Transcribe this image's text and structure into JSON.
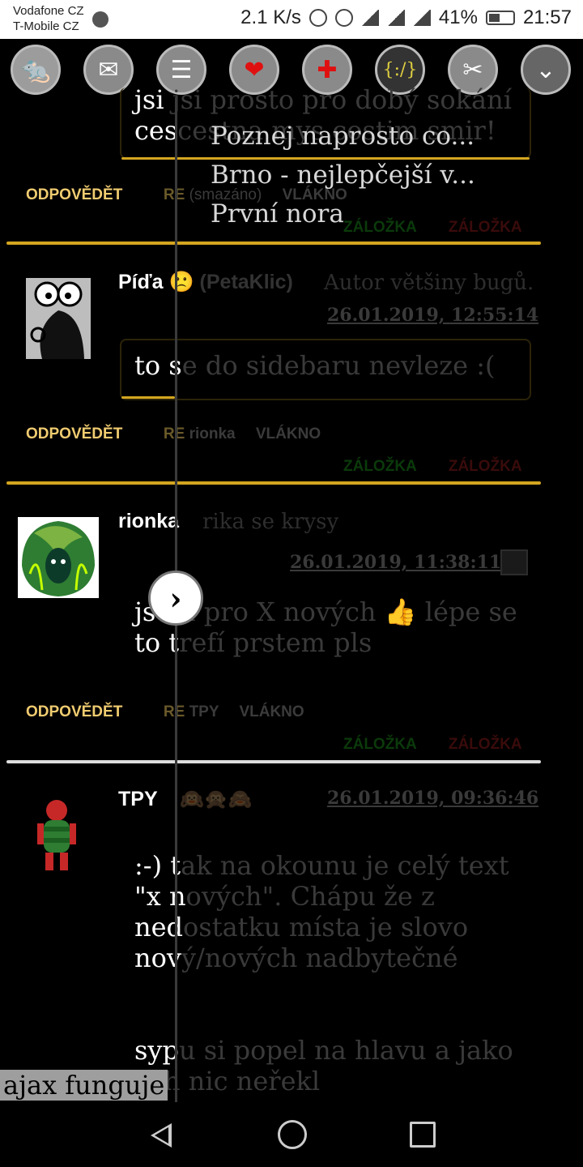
{
  "status_bar": {
    "carrier1": "Vodafone CZ",
    "carrier2": "T-Mobile CZ",
    "speed": "2.1 K/s",
    "battery": "41%",
    "time": "21:57"
  },
  "toolbar": {
    "icons": [
      "profile-icon",
      "mail-icon",
      "list-icon",
      "heart-icon",
      "add-icon",
      "code-icon",
      "tools-icon",
      "expand-icon"
    ]
  },
  "menu": {
    "items": [
      "Poznej naprosto co...",
      "Brno - nejlepčejší v...",
      "První nora"
    ]
  },
  "posts": [
    {
      "text_lines": [
        "jsi prosto pro dobý sokání",
        "cestna mys  costim smir!"
      ],
      "lit_parts": [
        "jsi ",
        "ces"
      ],
      "actions": {
        "reply": "ODPOVĚDĚT",
        "re": "RE",
        "re_target": "(smazáno)",
        "thread": "VLÁKNO"
      },
      "bookmarks": [
        "ZÁLOŽKA",
        "ZÁLOŽKA"
      ]
    },
    {
      "author": "Píďa",
      "emoji": "🙁",
      "nick": "(PetaKlic)",
      "motto": "Autor většiny bugů.",
      "date": "26.01.2019, 12:55:14",
      "text_lit": "to s",
      "text_rest": "e do sidebaru nevleze :(",
      "actions": {
        "reply": "ODPOVĚDĚT",
        "re": "RE",
        "re_target": "rionka",
        "thread": "VLÁKNO"
      },
      "bookmarks": [
        "ZÁLOŽKA",
        "ZÁLOŽKA"
      ]
    },
    {
      "author": "rionka",
      "motto": "rika se krysy",
      "date": "26.01.2019, 11:38:11",
      "line1_lit": "js",
      "line1_rest": "em pro X nových 👍 lépe se",
      "line2_lit": "to t",
      "line2_rest": "refí prstem pls",
      "actions": {
        "reply": "ODPOVĚDĚT",
        "re": "RE",
        "re_target": "TPY",
        "thread": "VLÁKNO"
      },
      "bookmarks": [
        "ZÁLOŽKA",
        "ZÁLOŽKA"
      ]
    },
    {
      "author": "TPY",
      "emojis": "🙉🙊🙈",
      "date": "26.01.2019, 09:36:46",
      "lines": [
        {
          "lit": ":-) t",
          "rest": "ak na okounu je celý text"
        },
        {
          "lit": "\"x n",
          "rest": "ových\". Chápu že z"
        },
        {
          "lit": "ned",
          "rest": "ostatku místa je slovo"
        },
        {
          "lit": "nov",
          "rest": "ý/nových nadbytečné"
        },
        {
          "lit": "syp",
          "rest": "u si popel na hlavu a jako"
        },
        {
          "lit": "",
          "rest": "ych nic neřekl"
        }
      ]
    }
  ],
  "toast": "ajax funguje"
}
